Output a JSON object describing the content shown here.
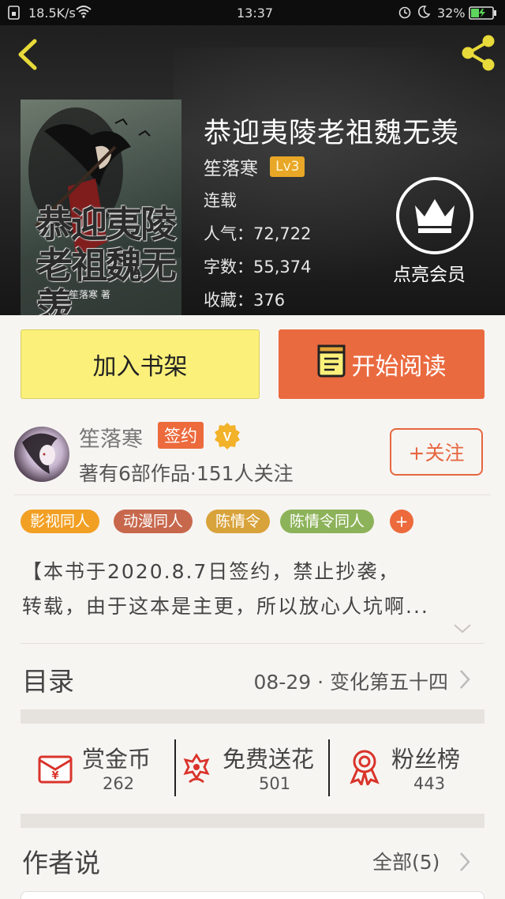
{
  "status_bar": {
    "speed": "18.5K/s",
    "time": "13:37",
    "battery": "32%"
  },
  "book": {
    "title": "恭迎夷陵老祖魏无羡",
    "author": "笙落寒",
    "level": "Lv3",
    "status": "连载",
    "popularity": "人气：72,722",
    "word_count": "字数：55,374",
    "favorites": "收藏：376",
    "cover_title": "恭迎夷陵老祖魏无羡",
    "cover_author": "笙落寒 著"
  },
  "vip": {
    "label": "点亮会员"
  },
  "actions": {
    "add_shelf": "加入书架",
    "start_reading": "开始阅读"
  },
  "author_card": {
    "name": "笙落寒",
    "sign_badge": "签约",
    "v_badge": "V",
    "subtitle": "著有6部作品·151人关注",
    "follow": "+关注"
  },
  "tags": [
    {
      "label": "影视同人",
      "color": "#f2a024"
    },
    {
      "label": "动漫同人",
      "color": "#c7684d"
    },
    {
      "label": "陈情令",
      "color": "#d9a33b"
    },
    {
      "label": "陈情令同人",
      "color": "#8db35a"
    }
  ],
  "tag_more": "+",
  "description": {
    "line1": "【本书于2020.8.7日签约，禁止抄袭，",
    "line2": "转载，由于这本是主更，所以放心人坑啊..."
  },
  "toc": {
    "label": "目录",
    "latest": "08-29 · 变化第五十四"
  },
  "stats": [
    {
      "label": "赏金币",
      "value": "262",
      "icon": "red-envelope-icon"
    },
    {
      "label": "免费送花",
      "value": "501",
      "icon": "flower-icon"
    },
    {
      "label": "粉丝榜",
      "value": "443",
      "icon": "medal-icon"
    }
  ],
  "author_says": {
    "label": "作者说",
    "all": "全部(5)"
  },
  "colors": {
    "accent": "#ea6a3f",
    "shelf_button": "#fbf07a",
    "level_badge": "#e8a726",
    "icon_red": "#d9342b"
  }
}
